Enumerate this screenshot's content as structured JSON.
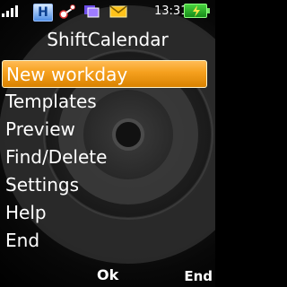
{
  "status_bar": {
    "time": "13:31",
    "signal_icon": "signal-strength-icon",
    "h_icon": "hsdpa-indicator-icon",
    "h_label": "H",
    "service_icon": "service-status-icon",
    "message_icon": "message-icon",
    "mail_icon": "email-icon",
    "battery_icon": "battery-charging-icon"
  },
  "app": {
    "title": "ShiftCalendar"
  },
  "menu": {
    "items": [
      {
        "label": "New workday"
      },
      {
        "label": "Templates"
      },
      {
        "label": "Preview"
      },
      {
        "label": "Find/Delete"
      },
      {
        "label": "Settings"
      },
      {
        "label": "Help"
      },
      {
        "label": "End"
      }
    ],
    "selected_index": 0
  },
  "softkeys": {
    "center_label": "Ok",
    "right_label": "End"
  },
  "colors": {
    "selected_background": "#f6a11f",
    "battery_green": "#37c62f",
    "text": "#ffffff",
    "background": "#000000"
  }
}
